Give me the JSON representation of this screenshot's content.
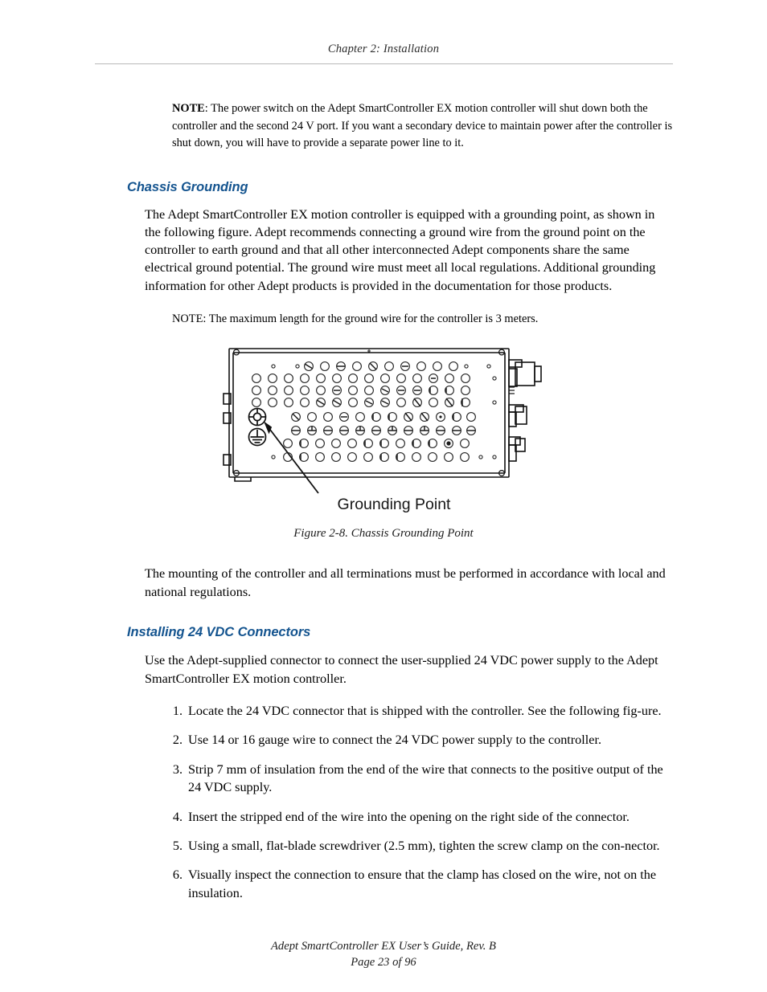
{
  "header": {
    "chapter_title": "Chapter 2: Installation"
  },
  "notes": {
    "power_switch": {
      "lead": "NOTE",
      "text": ": The power switch on the Adept SmartController EX motion controller will shut down both the controller and the second 24 V port. If you want a secondary device to maintain power after the controller is shut down, you will have to provide a separate power line to it."
    },
    "ground_wire_length": {
      "lead": "NOTE",
      "text": ": The maximum length for the ground wire for the controller is 3 meters."
    }
  },
  "sections": {
    "chassis_grounding": {
      "heading": "Chassis Grounding",
      "paragraph": "The Adept SmartController EX motion controller is equipped with a grounding point, as shown in the following figure. Adept recommends connecting a ground wire from the ground point on the controller to earth ground and that all other interconnected Adept components share the same electrical ground potential. The ground wire must meet all local regulations. Additional grounding information for other Adept products is provided in the documentation for those products.",
      "closing_paragraph": "The mounting of the controller and all terminations must be performed in accordance with local and national regulations."
    },
    "installing_24vdc": {
      "heading": "Installing 24 VDC Connectors",
      "intro": "Use the Adept-supplied connector to connect the user-supplied 24 VDC power supply to the Adept SmartController EX motion controller.",
      "steps": [
        {
          "number": "1.",
          "text": "Locate the 24 VDC connector that is shipped with the controller. See the following fig-ure."
        },
        {
          "number": "2.",
          "text": "Use 14 or 16 gauge wire to connect the 24 VDC power supply to the controller."
        },
        {
          "number": "3.",
          "text": "Strip 7 mm of insulation from the end of the wire that connects to the positive output of the 24 VDC supply."
        },
        {
          "number": "4.",
          "text": "Insert the stripped end of the wire into the opening on the right side of the connector."
        },
        {
          "number": "5.",
          "text": "Using a small, flat-blade screwdriver (2.5 mm), tighten the screw clamp on the con-nector."
        },
        {
          "number": "6.",
          "text": "Visually inspect the connection to ensure that the clamp has closed on the wire, not on the insulation."
        }
      ]
    }
  },
  "figure": {
    "caption": "Figure 2-8. Chassis Grounding Point",
    "callout_label": "Grounding Point",
    "symbols": {
      "screw_icon": "circled-screw-icon",
      "ground_icon": "circled-earth-ground-icon"
    }
  },
  "footer": {
    "line1": "Adept SmartController EX User’s Guide, Rev. B",
    "line2": "Page 23 of 96"
  },
  "colors": {
    "heading_blue": "#14548f",
    "rule_gray": "#b9b9b9",
    "line_art": "#111111"
  }
}
